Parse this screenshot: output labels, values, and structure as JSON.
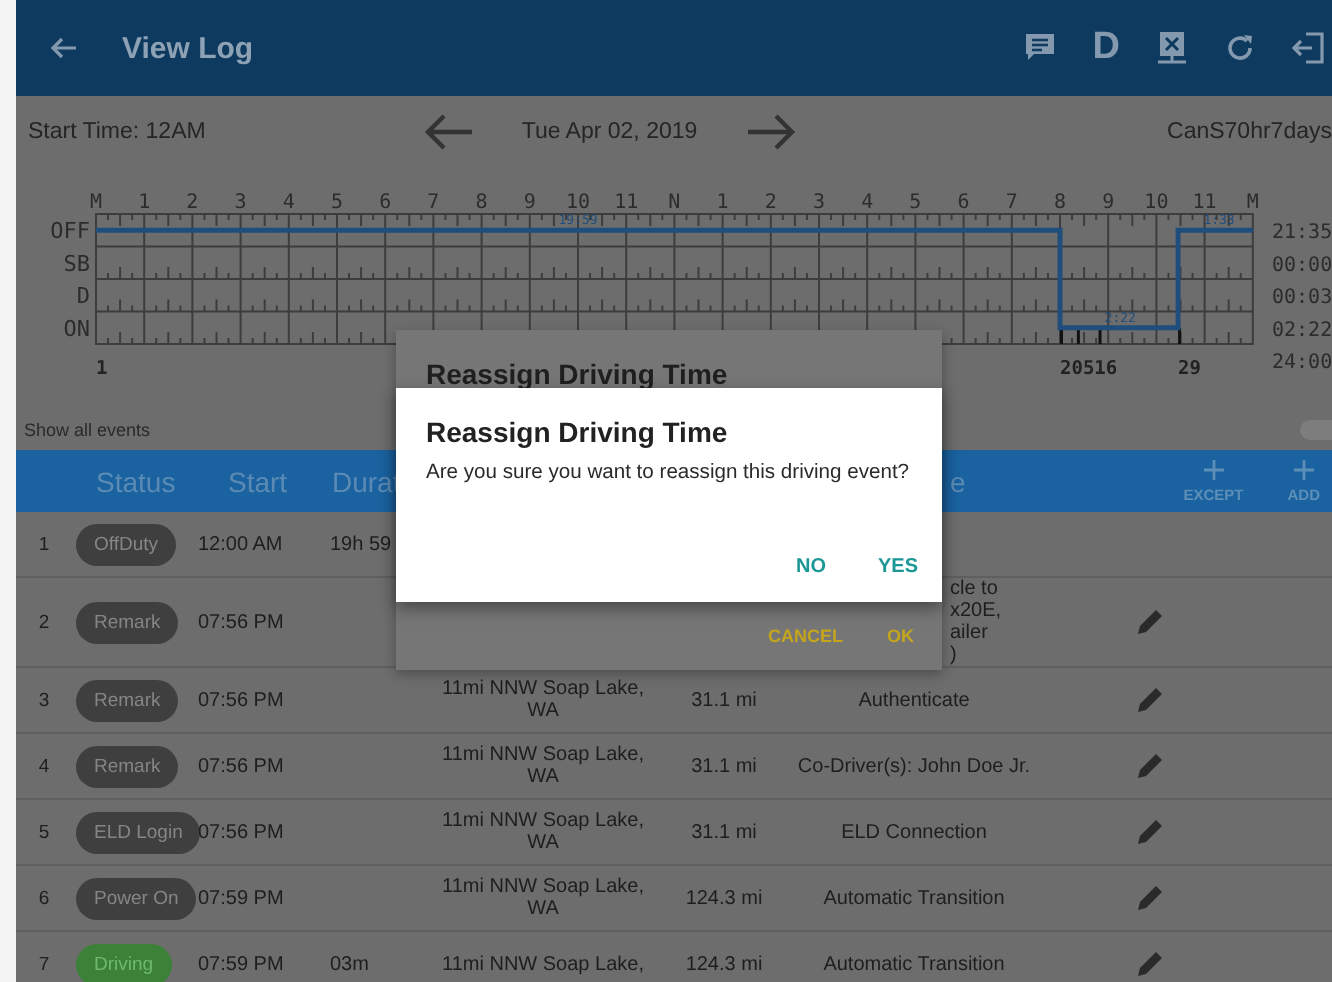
{
  "app_bar": {
    "title": "View Log",
    "d_button": "D"
  },
  "log_header": {
    "start_time": "Start Time: 12AM",
    "date": "Tue Apr 02, 2019",
    "ruleset": "CanS70hr7days"
  },
  "graph": {
    "hour_labels": [
      "M",
      "1",
      "2",
      "3",
      "4",
      "5",
      "6",
      "7",
      "8",
      "9",
      "10",
      "11",
      "N",
      "1",
      "2",
      "3",
      "4",
      "5",
      "6",
      "7",
      "8",
      "9",
      "10",
      "11",
      "M"
    ],
    "row_labels": [
      "OFF",
      "SB",
      "D",
      "ON"
    ],
    "duration_labels": [
      "19:59",
      "2:22",
      "1:33"
    ],
    "event_markers": [
      "1",
      "20516",
      "29"
    ],
    "totals": [
      "21:35",
      "00:00",
      "00:03",
      "02:22",
      "24:00"
    ]
  },
  "show_all_events": {
    "label": "Show all events",
    "on": false
  },
  "table": {
    "columns": [
      "Status",
      "Start",
      "Durat",
      "e"
    ],
    "actions": [
      {
        "label": "EXCEPT"
      },
      {
        "label": "ADD"
      }
    ],
    "rows": [
      {
        "number": "1",
        "status": "OffDuty",
        "kind": "neutral",
        "start": "12:00 AM",
        "duration": "19h 59",
        "editable": false
      },
      {
        "number": "2",
        "status": "Remark",
        "kind": "neutral",
        "start": "07:56 PM",
        "note": "cle to\nx20E,\nailer\n)",
        "note_covered": true,
        "editable": true
      },
      {
        "number": "3",
        "status": "Remark",
        "kind": "neutral",
        "start": "07:56 PM",
        "location": "11mi NNW Soap Lake, WA",
        "distance": "31.1 mi",
        "note": "Authenticate",
        "note_covered": false,
        "editable": true
      },
      {
        "number": "4",
        "status": "Remark",
        "kind": "neutral",
        "start": "07:56 PM",
        "location": "11mi NNW Soap Lake, WA",
        "distance": "31.1 mi",
        "note": "Co-Driver(s): John Doe Jr.",
        "note_covered": false,
        "editable": true
      },
      {
        "number": "5",
        "status": "ELD Login",
        "kind": "neutral",
        "start": "07:56 PM",
        "location": "11mi NNW Soap Lake, WA",
        "distance": "31.1 mi",
        "note": "ELD Connection",
        "note_covered": false,
        "editable": true
      },
      {
        "number": "6",
        "status": "Power On",
        "kind": "neutral",
        "start": "07:59 PM",
        "location": "11mi NNW Soap Lake, WA",
        "distance": "124.3 mi",
        "note": "Automatic Transition",
        "note_covered": false,
        "editable": true
      },
      {
        "number": "7",
        "status": "Driving",
        "kind": "driving",
        "start": "07:59 PM",
        "duration": "03m",
        "location": "11mi NNW Soap Lake,",
        "distance": "124.3 mi",
        "note": "Automatic Transition",
        "note_covered": false,
        "editable": true
      }
    ]
  },
  "background_dialog": {
    "title": "Reassign Driving Time",
    "buttons": [
      "CANCEL",
      "OK"
    ]
  },
  "dialog": {
    "title": "Reassign Driving Time",
    "message": "Are you sure you want to reassign this driving event?",
    "buttons": [
      "NO",
      "YES"
    ]
  }
}
